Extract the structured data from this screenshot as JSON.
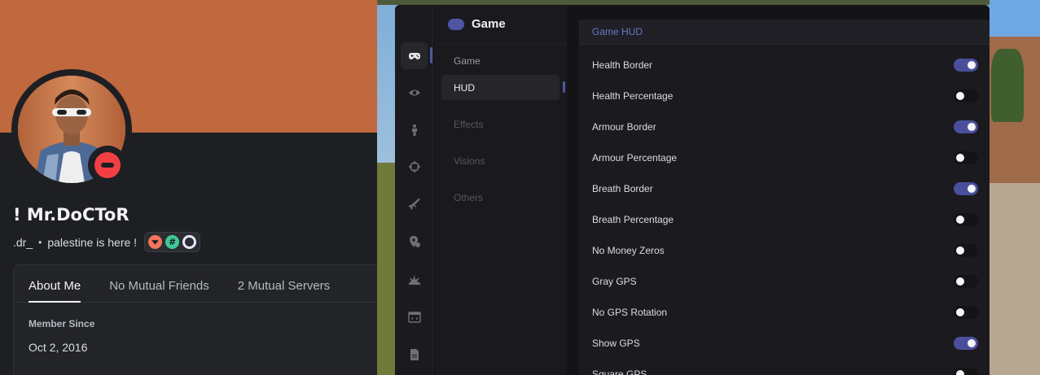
{
  "profile": {
    "display_name": "! Mr.DoCToR",
    "username": ".dr_",
    "separator": "•",
    "custom_status": "palestine is here !",
    "badges": [
      "hypesquad-balance-badge",
      "server-tag-badge",
      "nitro-boost-badge"
    ],
    "status": "do-not-disturb",
    "colors": {
      "banner": "#c0683e",
      "status_dnd": "#f23f43"
    },
    "tabs": [
      {
        "label": "About Me",
        "active": true
      },
      {
        "label": "No Mutual Friends",
        "active": false
      },
      {
        "label": "2 Mutual Servers",
        "active": false
      }
    ],
    "member_since_label": "Member Since",
    "member_since_value": "Oct 2, 2016"
  },
  "menu": {
    "rail_icons": [
      "gamepad-icon",
      "eye-icon",
      "person-icon",
      "crosshair-icon",
      "weapon-icon",
      "location-settings-icon",
      "explosion-icon",
      "code-window-icon",
      "document-icon"
    ],
    "active_rail": "gamepad-icon",
    "category_title": "Game",
    "section_label": "Game",
    "categories": [
      {
        "label": "HUD",
        "active": true
      },
      {
        "label": "Effects",
        "active": false
      },
      {
        "label": "Visions",
        "active": false
      },
      {
        "label": "Others",
        "active": false
      }
    ],
    "panel_title": "Game HUD",
    "options": [
      {
        "label": "Health Border",
        "enabled": true
      },
      {
        "label": "Health Percentage",
        "enabled": false
      },
      {
        "label": "Armour Border",
        "enabled": true
      },
      {
        "label": "Armour Percentage",
        "enabled": false
      },
      {
        "label": "Breath Border",
        "enabled": true
      },
      {
        "label": "Breath Percentage",
        "enabled": false
      },
      {
        "label": "No Money Zeros",
        "enabled": false
      },
      {
        "label": "Gray GPS",
        "enabled": false
      },
      {
        "label": "No GPS Rotation",
        "enabled": false
      },
      {
        "label": "Show GPS",
        "enabled": true
      },
      {
        "label": "Square GPS",
        "enabled": false
      }
    ],
    "colors": {
      "accent": "#4a4f9c",
      "accent_text": "#6f74c6"
    }
  }
}
